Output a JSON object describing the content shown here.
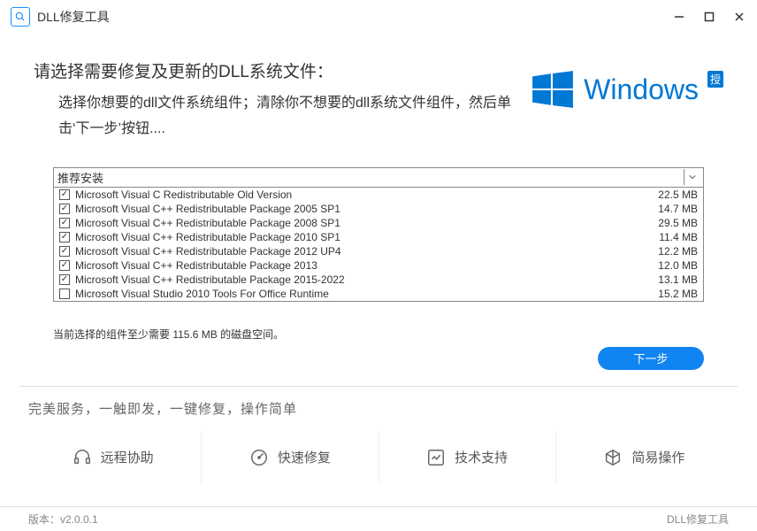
{
  "app": {
    "title": "DLL修复工具"
  },
  "header": {
    "title": "请选择需要修复及更新的DLL系统文件：",
    "subtitle": "选择你想要的dll文件系统组件；清除你不想要的dll系统文件组件，然后单击‘下一步’按钮...."
  },
  "branding": {
    "name": "Windows",
    "badge": "授"
  },
  "dropdown": {
    "label": "推荐安装"
  },
  "items": [
    {
      "checked": true,
      "name": "Microsoft Visual C Redistributable Old Version",
      "size": "22.5 MB"
    },
    {
      "checked": true,
      "name": "Microsoft Visual C++ Redistributable Package 2005 SP1",
      "size": "14.7 MB"
    },
    {
      "checked": true,
      "name": "Microsoft Visual C++ Redistributable Package 2008 SP1",
      "size": "29.5 MB"
    },
    {
      "checked": true,
      "name": "Microsoft Visual C++ Redistributable Package 2010 SP1",
      "size": "11.4 MB"
    },
    {
      "checked": true,
      "name": "Microsoft Visual C++ Redistributable Package 2012 UP4",
      "size": "12.2 MB"
    },
    {
      "checked": true,
      "name": "Microsoft Visual C++ Redistributable Package 2013",
      "size": "12.0 MB"
    },
    {
      "checked": true,
      "name": "Microsoft Visual C++ Redistributable Package 2015-2022",
      "size": "13.1 MB"
    },
    {
      "checked": false,
      "name": "Microsoft Visual Studio 2010 Tools For Office Runtime",
      "size": "15.2 MB"
    }
  ],
  "disk_note": "当前选择的组件至少需要 115.6 MB 的磁盘空间。",
  "actions": {
    "next": "下一步"
  },
  "tagline": "完美服务，一触即发，一键修复，操作简单",
  "features": [
    {
      "label": "远程协助",
      "icon": "headset-icon"
    },
    {
      "label": "快速修复",
      "icon": "speed-icon"
    },
    {
      "label": "技术支持",
      "icon": "chart-icon"
    },
    {
      "label": "简易操作",
      "icon": "cube-icon"
    }
  ],
  "status": {
    "version_label": "版本：",
    "version": "v2.0.0.1",
    "brand": "DLL修复工具"
  }
}
